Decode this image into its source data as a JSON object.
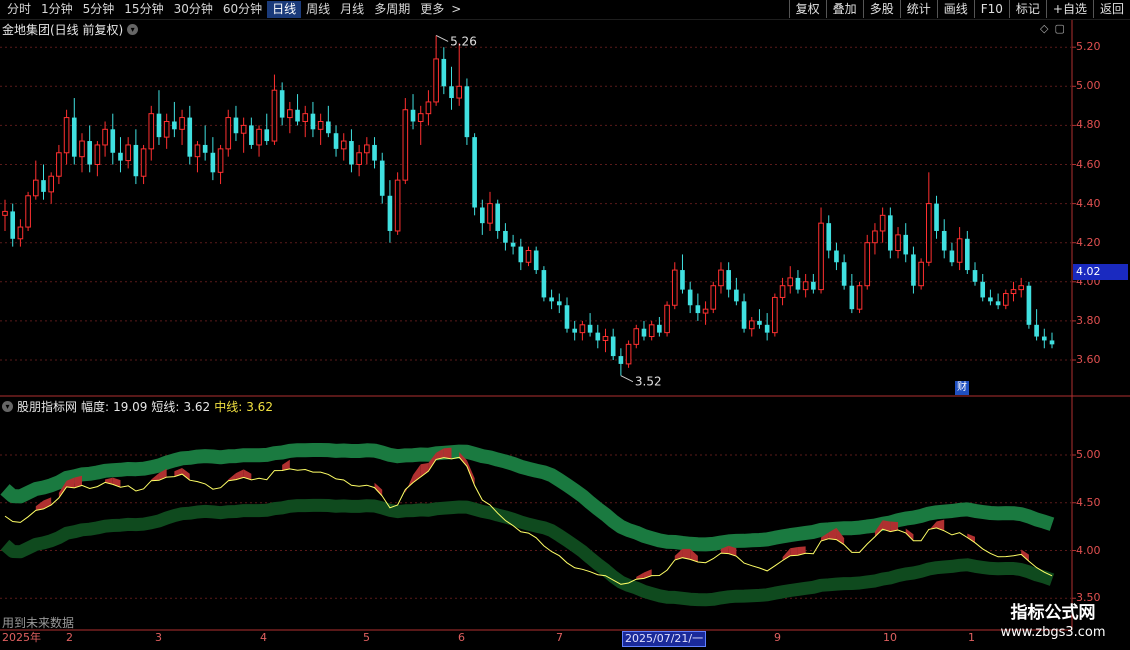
{
  "toolbar": {
    "periods": [
      "分时",
      "1分钟",
      "5分钟",
      "15分钟",
      "30分钟",
      "60分钟",
      "日线",
      "周线",
      "月线",
      "多周期",
      "更多"
    ],
    "active_period": "日线",
    "more_arrow": ">",
    "right_buttons": [
      "复权",
      "叠加",
      "多股",
      "统计",
      "画线",
      "F10",
      "标记",
      "+自选",
      "返回"
    ]
  },
  "main_chart": {
    "title": "金地集团(日线 前复权)",
    "high_label": "5.26",
    "low_label": "3.52",
    "current_price": "4.02",
    "cai_badge": "财",
    "y_ticks": [
      "5.20",
      "5.00",
      "4.80",
      "4.60",
      "4.40",
      "4.20",
      "4.00",
      "3.80",
      "3.60"
    ]
  },
  "indicator": {
    "name": "股朋指标网",
    "amp_label": "幅度:",
    "amp_value": "19.09",
    "short_label": "短线:",
    "short_value": "3.62",
    "mid_label": "中线:",
    "mid_value": "3.62",
    "y_ticks": [
      "5.00",
      "4.50",
      "4.00",
      "3.50"
    ],
    "future_note": "用到未来数据"
  },
  "date_axis": {
    "labels": [
      "2025年",
      "2",
      "3",
      "4",
      "5",
      "6",
      "7",
      "2025/07/21/一",
      "9",
      "10",
      "1"
    ]
  },
  "watermark": {
    "line1": "指标公式网",
    "line2": "www.zbgs3.com"
  },
  "colors": {
    "up": "#ff3030",
    "down": "#40e0e0",
    "band_upper": "#1a7a40",
    "band_lower": "#0f4a1e",
    "short_line": "#ffff66",
    "fill_red": "#b03030"
  },
  "chart_data": {
    "type": "candlestick",
    "ylim": [
      3.52,
      5.3
    ],
    "candles": [
      [
        4.34,
        4.42,
        4.26,
        4.36
      ],
      [
        4.36,
        4.4,
        4.18,
        4.22
      ],
      [
        4.22,
        4.32,
        4.18,
        4.28
      ],
      [
        4.28,
        4.46,
        4.26,
        4.44
      ],
      [
        4.44,
        4.62,
        4.42,
        4.52
      ],
      [
        4.52,
        4.6,
        4.42,
        4.46
      ],
      [
        4.46,
        4.56,
        4.4,
        4.54
      ],
      [
        4.54,
        4.7,
        4.5,
        4.66
      ],
      [
        4.66,
        4.88,
        4.6,
        4.84
      ],
      [
        4.84,
        4.94,
        4.6,
        4.64
      ],
      [
        4.64,
        4.76,
        4.56,
        4.72
      ],
      [
        4.72,
        4.8,
        4.56,
        4.6
      ],
      [
        4.6,
        4.72,
        4.54,
        4.7
      ],
      [
        4.7,
        4.82,
        4.64,
        4.78
      ],
      [
        4.78,
        4.86,
        4.6,
        4.66
      ],
      [
        4.66,
        4.74,
        4.56,
        4.62
      ],
      [
        4.62,
        4.74,
        4.58,
        4.7
      ],
      [
        4.7,
        4.78,
        4.5,
        4.54
      ],
      [
        4.54,
        4.7,
        4.5,
        4.68
      ],
      [
        4.68,
        4.9,
        4.62,
        4.86
      ],
      [
        4.86,
        4.98,
        4.7,
        4.74
      ],
      [
        4.74,
        4.86,
        4.68,
        4.82
      ],
      [
        4.82,
        4.92,
        4.74,
        4.78
      ],
      [
        4.78,
        4.88,
        4.7,
        4.84
      ],
      [
        4.84,
        4.9,
        4.6,
        4.64
      ],
      [
        4.64,
        4.72,
        4.56,
        4.7
      ],
      [
        4.7,
        4.8,
        4.62,
        4.66
      ],
      [
        4.66,
        4.74,
        4.52,
        4.56
      ],
      [
        4.56,
        4.7,
        4.5,
        4.68
      ],
      [
        4.68,
        4.88,
        4.64,
        4.84
      ],
      [
        4.84,
        4.9,
        4.72,
        4.76
      ],
      [
        4.76,
        4.84,
        4.66,
        4.8
      ],
      [
        4.8,
        4.84,
        4.68,
        4.7
      ],
      [
        4.7,
        4.8,
        4.64,
        4.78
      ],
      [
        4.78,
        4.86,
        4.7,
        4.72
      ],
      [
        4.72,
        5.06,
        4.7,
        4.98
      ],
      [
        4.98,
        5.02,
        4.8,
        4.84
      ],
      [
        4.84,
        4.92,
        4.76,
        4.88
      ],
      [
        4.88,
        4.96,
        4.8,
        4.82
      ],
      [
        4.82,
        4.9,
        4.74,
        4.86
      ],
      [
        4.86,
        4.92,
        4.74,
        4.78
      ],
      [
        4.78,
        4.86,
        4.7,
        4.82
      ],
      [
        4.82,
        4.9,
        4.74,
        4.76
      ],
      [
        4.76,
        4.8,
        4.64,
        4.68
      ],
      [
        4.68,
        4.76,
        4.62,
        4.72
      ],
      [
        4.72,
        4.78,
        4.56,
        4.6
      ],
      [
        4.6,
        4.7,
        4.54,
        4.66
      ],
      [
        4.66,
        4.74,
        4.6,
        4.7
      ],
      [
        4.7,
        4.74,
        4.58,
        4.62
      ],
      [
        4.62,
        4.66,
        4.4,
        4.44
      ],
      [
        4.44,
        4.52,
        4.2,
        4.26
      ],
      [
        4.26,
        4.56,
        4.24,
        4.52
      ],
      [
        4.52,
        4.94,
        4.5,
        4.88
      ],
      [
        4.88,
        4.96,
        4.78,
        4.82
      ],
      [
        4.82,
        4.9,
        4.7,
        4.86
      ],
      [
        4.86,
        4.98,
        4.8,
        4.92
      ],
      [
        4.92,
        5.26,
        4.9,
        5.14
      ],
      [
        5.14,
        5.2,
        4.96,
        5.0
      ],
      [
        5.0,
        5.1,
        4.88,
        4.94
      ],
      [
        4.94,
        5.22,
        4.9,
        5.0
      ],
      [
        5.0,
        5.04,
        4.7,
        4.74
      ],
      [
        4.74,
        4.76,
        4.34,
        4.38
      ],
      [
        4.38,
        4.42,
        4.24,
        4.3
      ],
      [
        4.3,
        4.46,
        4.26,
        4.4
      ],
      [
        4.4,
        4.42,
        4.22,
        4.26
      ],
      [
        4.26,
        4.3,
        4.16,
        4.2
      ],
      [
        4.2,
        4.24,
        4.14,
        4.18
      ],
      [
        4.18,
        4.22,
        4.06,
        4.1
      ],
      [
        4.1,
        4.18,
        4.08,
        4.16
      ],
      [
        4.16,
        4.18,
        4.04,
        4.06
      ],
      [
        4.06,
        4.08,
        3.9,
        3.92
      ],
      [
        3.92,
        3.96,
        3.86,
        3.9
      ],
      [
        3.9,
        3.94,
        3.84,
        3.88
      ],
      [
        3.88,
        3.92,
        3.74,
        3.76
      ],
      [
        3.76,
        3.8,
        3.7,
        3.74
      ],
      [
        3.74,
        3.8,
        3.7,
        3.78
      ],
      [
        3.78,
        3.84,
        3.72,
        3.74
      ],
      [
        3.74,
        3.78,
        3.66,
        3.7
      ],
      [
        3.7,
        3.76,
        3.64,
        3.72
      ],
      [
        3.72,
        3.76,
        3.6,
        3.62
      ],
      [
        3.62,
        3.66,
        3.52,
        3.58
      ],
      [
        3.58,
        3.7,
        3.56,
        3.68
      ],
      [
        3.68,
        3.78,
        3.66,
        3.76
      ],
      [
        3.76,
        3.8,
        3.7,
        3.72
      ],
      [
        3.72,
        3.8,
        3.7,
        3.78
      ],
      [
        3.78,
        3.82,
        3.72,
        3.74
      ],
      [
        3.74,
        3.9,
        3.72,
        3.88
      ],
      [
        3.88,
        4.1,
        3.86,
        4.06
      ],
      [
        4.06,
        4.14,
        3.94,
        3.96
      ],
      [
        3.96,
        4.0,
        3.84,
        3.88
      ],
      [
        3.88,
        3.94,
        3.8,
        3.84
      ],
      [
        3.84,
        3.9,
        3.78,
        3.86
      ],
      [
        3.86,
        4.0,
        3.84,
        3.98
      ],
      [
        3.98,
        4.1,
        3.94,
        4.06
      ],
      [
        4.06,
        4.1,
        3.92,
        3.96
      ],
      [
        3.96,
        4.02,
        3.88,
        3.9
      ],
      [
        3.9,
        3.94,
        3.74,
        3.76
      ],
      [
        3.76,
        3.82,
        3.72,
        3.8
      ],
      [
        3.8,
        3.86,
        3.76,
        3.78
      ],
      [
        3.78,
        3.84,
        3.7,
        3.74
      ],
      [
        3.74,
        3.94,
        3.72,
        3.92
      ],
      [
        3.92,
        4.02,
        3.88,
        3.98
      ],
      [
        3.98,
        4.08,
        3.94,
        4.02
      ],
      [
        4.02,
        4.06,
        3.94,
        3.96
      ],
      [
        3.96,
        4.04,
        3.92,
        4.0
      ],
      [
        4.0,
        4.04,
        3.94,
        3.96
      ],
      [
        3.96,
        4.38,
        3.94,
        4.3
      ],
      [
        4.3,
        4.34,
        4.12,
        4.16
      ],
      [
        4.16,
        4.2,
        4.06,
        4.1
      ],
      [
        4.1,
        4.14,
        3.96,
        3.98
      ],
      [
        3.98,
        4.04,
        3.84,
        3.86
      ],
      [
        3.86,
        4.0,
        3.84,
        3.98
      ],
      [
        3.98,
        4.24,
        3.96,
        4.2
      ],
      [
        4.2,
        4.3,
        4.14,
        4.26
      ],
      [
        4.26,
        4.38,
        4.2,
        4.34
      ],
      [
        4.34,
        4.38,
        4.12,
        4.16
      ],
      [
        4.16,
        4.28,
        4.12,
        4.24
      ],
      [
        4.24,
        4.3,
        4.1,
        4.14
      ],
      [
        4.14,
        4.18,
        3.94,
        3.98
      ],
      [
        3.98,
        4.12,
        3.96,
        4.1
      ],
      [
        4.1,
        4.56,
        4.08,
        4.4
      ],
      [
        4.4,
        4.44,
        4.22,
        4.26
      ],
      [
        4.26,
        4.32,
        4.12,
        4.16
      ],
      [
        4.16,
        4.2,
        4.08,
        4.1
      ],
      [
        4.1,
        4.28,
        4.06,
        4.22
      ],
      [
        4.22,
        4.26,
        4.04,
        4.06
      ],
      [
        4.06,
        4.1,
        3.98,
        4.0
      ],
      [
        4.0,
        4.04,
        3.9,
        3.92
      ],
      [
        3.92,
        3.96,
        3.88,
        3.9
      ],
      [
        3.9,
        3.94,
        3.86,
        3.88
      ],
      [
        3.88,
        3.96,
        3.86,
        3.94
      ],
      [
        3.94,
        4.0,
        3.9,
        3.96
      ],
      [
        3.96,
        4.02,
        3.92,
        3.98
      ],
      [
        3.98,
        4.0,
        3.76,
        3.78
      ],
      [
        3.78,
        3.86,
        3.7,
        3.72
      ],
      [
        3.72,
        3.76,
        3.66,
        3.7
      ],
      [
        3.7,
        3.74,
        3.66,
        3.68
      ]
    ]
  }
}
